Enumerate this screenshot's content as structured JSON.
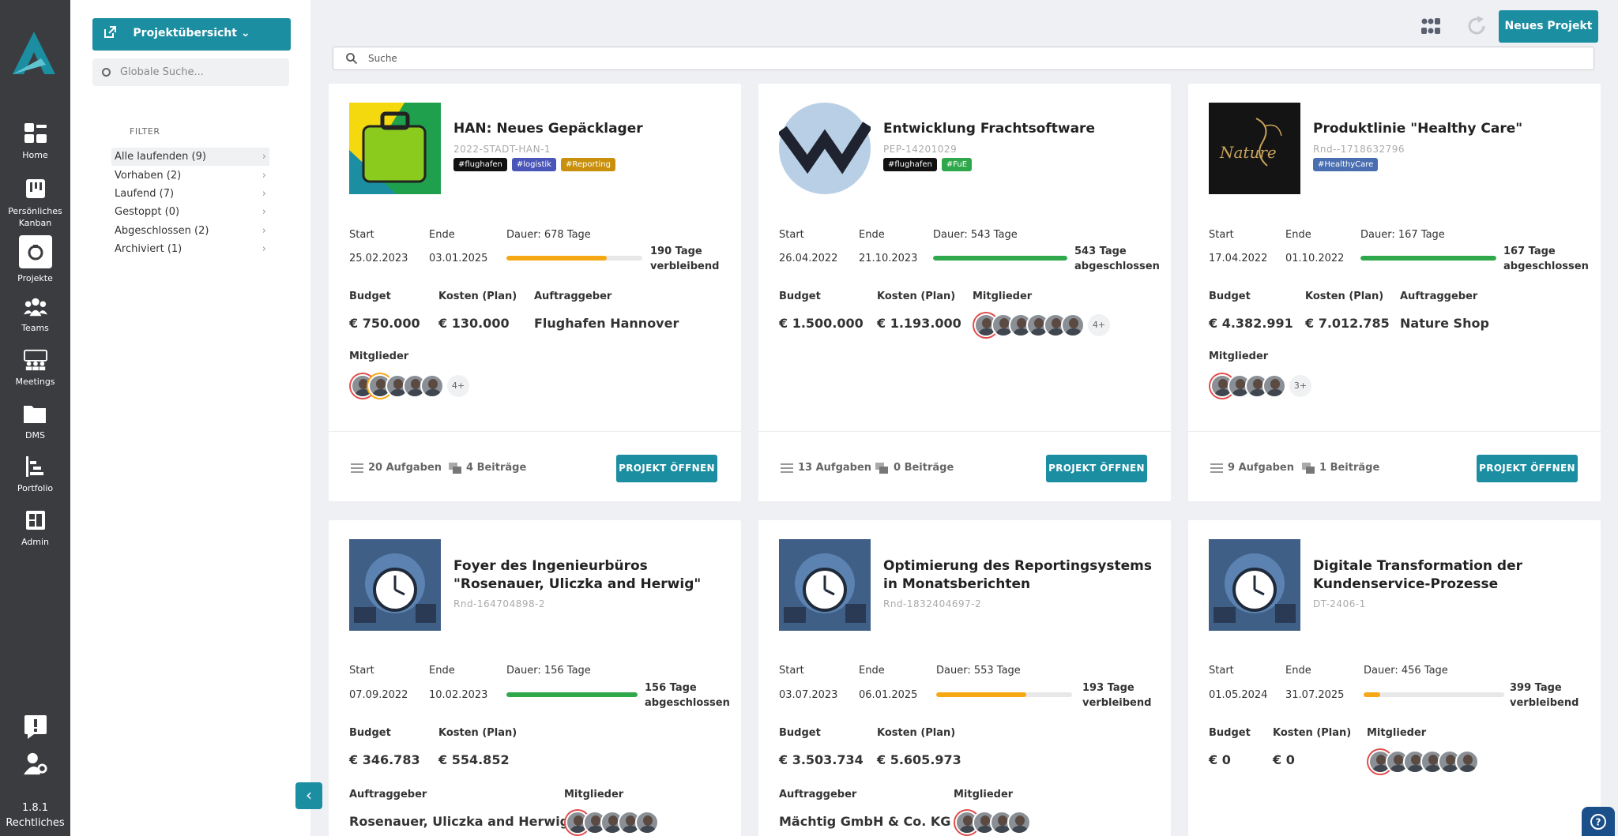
{
  "rail": {
    "items": [
      {
        "label": "Home",
        "icon": "home-icon"
      },
      {
        "label": "Persönliches Kanban",
        "icon": "kanban-icon"
      },
      {
        "label": "Projekte",
        "icon": "projects-icon"
      },
      {
        "label": "Teams",
        "icon": "teams-icon"
      },
      {
        "label": "Meetings",
        "icon": "meetings-icon"
      },
      {
        "label": "DMS",
        "icon": "folder-icon"
      },
      {
        "label": "Portfolio",
        "icon": "portfolio-icon"
      },
      {
        "label": "Admin",
        "icon": "admin-icon"
      }
    ],
    "version": "1.8.1",
    "legal": "Rechtliches"
  },
  "panel": {
    "project_button": "Projektübersicht ⌄",
    "global_search_placeholder": "Globale Suche...",
    "filter_title": "FILTER",
    "filters": [
      "Alle laufenden (9)",
      "Vorhaben (2)",
      "Laufend (7)",
      "Gestoppt (0)",
      "Abgeschlossen (2)",
      "Archiviert (1)"
    ]
  },
  "topbar": {
    "new_project": "Neues Projekt",
    "search_placeholder": "Suche"
  },
  "colors": {
    "accent": "#1b8ea1",
    "progress_yellow": "#f5a814",
    "progress_green": "#2ea84a",
    "tag_black": "#111111",
    "tag_blue": "#4a55b8",
    "tag_gold": "#c8900c",
    "tag_green": "#2ea84a",
    "tag_steel": "#4a6fb0"
  },
  "cards": [
    {
      "title": "HAN: Neues Gepäcklager",
      "code": "2022-STADT-HAN-1",
      "tags": [
        {
          "text": "#flughafen",
          "color": "#111111"
        },
        {
          "text": "#logistik",
          "color": "#4a55b8"
        },
        {
          "text": "#Reporting",
          "color": "#c8900c"
        }
      ],
      "start_label": "Start",
      "end_label": "Ende",
      "start": "25.02.2023",
      "end": "03.01.2025",
      "duration": "Dauer: 678 Tage",
      "progress": 0.74,
      "progress_color": "#f5a814",
      "remaining_1": "190 Tage",
      "remaining_2": "verbleibend",
      "budget_label": "Budget",
      "costs_label": "Kosten (Plan)",
      "client_label": "Auftraggeber",
      "budget": "€ 750.000",
      "costs": "€ 130.000",
      "client": "Flughafen Hannover",
      "members_label": "Mitglieder",
      "members_more": "4+",
      "tasks": "20 Aufgaben",
      "posts": "4 Beiträge",
      "open": "PROJEKT ÖFFNEN"
    },
    {
      "title": "Entwicklung Frachtsoftware",
      "code": "PEP-14201029",
      "tags": [
        {
          "text": "#flughafen",
          "color": "#111111"
        },
        {
          "text": "#FuE",
          "color": "#2ea84a"
        }
      ],
      "start_label": "Start",
      "end_label": "Ende",
      "start": "26.04.2022",
      "end": "21.10.2023",
      "duration": "Dauer: 543 Tage",
      "progress": 1.0,
      "progress_color": "#2ea84a",
      "remaining_1": "543 Tage",
      "remaining_2": "abgeschlossen",
      "budget_label": "Budget",
      "costs_label": "Kosten (Plan)",
      "client_label": "Mitglieder",
      "budget": "€ 1.500.000",
      "costs": "€ 1.193.000",
      "members_more": "4+",
      "tasks": "13 Aufgaben",
      "posts": "0 Beiträge",
      "open": "PROJEKT ÖFFNEN"
    },
    {
      "title": "Produktlinie \"Healthy Care\"",
      "code": "Rnd--1718632796",
      "tags": [
        {
          "text": "#HealthyCare",
          "color": "#4a6fb0"
        }
      ],
      "start_label": "Start",
      "end_label": "Ende",
      "start": "17.04.2022",
      "end": "01.10.2022",
      "duration": "Dauer: 167 Tage",
      "progress": 1.0,
      "progress_color": "#2ea84a",
      "remaining_1": "167 Tage",
      "remaining_2": "abgeschlossen",
      "budget_label": "Budget",
      "costs_label": "Kosten (Plan)",
      "client_label": "Auftraggeber",
      "budget": "€ 4.382.991",
      "costs": "€ 7.012.785",
      "client": "Nature Shop",
      "members_label": "Mitglieder",
      "members_more": "3+",
      "tasks": "9 Aufgaben",
      "posts": "1 Beiträge",
      "open": "PROJEKT ÖFFNEN",
      "logo_text": "Nature"
    },
    {
      "title": "Foyer des Ingenieurbüros \"Rosenauer, Uliczka and Herwig\"",
      "code": "Rnd-164704898-2",
      "start_label": "Start",
      "end_label": "Ende",
      "start": "07.09.2022",
      "end": "10.02.2023",
      "duration": "Dauer: 156 Tage",
      "progress": 1.0,
      "progress_color": "#2ea84a",
      "remaining_1": "156 Tage",
      "remaining_2": "abgeschlossen",
      "budget_label": "Budget",
      "costs_label": "Kosten (Plan)",
      "budget": "€ 346.783",
      "costs": "€ 554.852",
      "client_label": "Auftraggeber",
      "client": "Rosenauer, Uliczka and Herwig",
      "members_label": "Mitglieder"
    },
    {
      "title": "Optimierung des Reportingsystems in Monatsberichten",
      "code": "Rnd-1832404697-2",
      "start_label": "Start",
      "end_label": "Ende",
      "start": "03.07.2023",
      "end": "06.01.2025",
      "duration": "Dauer: 553 Tage",
      "progress": 0.66,
      "progress_color": "#f5a814",
      "remaining_1": "193 Tage",
      "remaining_2": "verbleibend",
      "budget_label": "Budget",
      "costs_label": "Kosten (Plan)",
      "budget": "€ 3.503.734",
      "costs": "€ 5.605.973",
      "client_label": "Auftraggeber",
      "client": "Mächtig GmbH & Co. KG",
      "members_label": "Mitglieder"
    },
    {
      "title": "Digitale Transformation der Kundenservice-Prozesse",
      "code": "DT-2406-1",
      "start_label": "Start",
      "end_label": "Ende",
      "start": "01.05.2024",
      "end": "31.07.2025",
      "duration": "Dauer: 456 Tage",
      "progress": 0.12,
      "progress_color": "#f5a814",
      "remaining_1": "399 Tage",
      "remaining_2": "verbleibend",
      "budget_label": "Budget",
      "costs_label": "Kosten (Plan)",
      "members_label": "Mitglieder",
      "budget": "€ 0",
      "costs": "€ 0"
    }
  ]
}
